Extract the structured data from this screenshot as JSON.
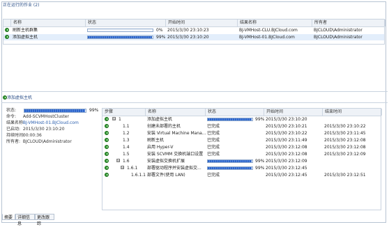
{
  "window": {
    "title": "正在运行的作业 (2)"
  },
  "jobs": {
    "columns": [
      "名称",
      "状态",
      "开始时间",
      "结果名称",
      "所有者"
    ],
    "rows": [
      {
        "name": "刷新主机群集",
        "progress": 0,
        "progress_text": "0%",
        "start": "2015/3/30 23:10:23",
        "result": "BJ-VMHost-CLU.BJCloud.com",
        "owner": "BJCLOUD\\Administrator"
      },
      {
        "name": "添加虚拟主机",
        "progress": 99,
        "progress_text": "99%",
        "start": "2015/3/30 23:10:20",
        "result": "BJ-VMHost-01.BJCloud.com",
        "owner": "BJCLOUD\\Administrator"
      }
    ]
  },
  "detail": {
    "title": "添加虚拟主机",
    "status_label": "状态:",
    "status_progress": 99,
    "status_progress_text": "99%",
    "command_label": "命令:",
    "command": "Add-SCVMHostCluster",
    "result_label": "结果名称:",
    "result": "BJ-VMHost-01.BJCloud.com",
    "started_label": "已启动:",
    "started": "2015/3/30 23:10:20",
    "duration_label": "持续时间:",
    "duration": "00:00:36",
    "owner_label": "所有者:",
    "owner": "BJCLOUD\\Administrator"
  },
  "steps": {
    "columns": [
      "步骤",
      "名称",
      "状态",
      "开始时间",
      "结束时间"
    ],
    "rows": [
      {
        "step": "1",
        "tree": "⊟",
        "name": "添加虚拟主机",
        "progress": 99,
        "status": "99%",
        "start": "2015/3/30 23:10:20",
        "end": ""
      },
      {
        "step": "1.1",
        "tree": "",
        "name": "创建未部署的主机",
        "progress": null,
        "status": "已完成",
        "start": "2015/3/30 23:10:21",
        "end": "2015/3/30 23:10:22"
      },
      {
        "step": "1.2",
        "tree": "",
        "name": "安装 Virtual Machine Mana...",
        "progress": null,
        "status": "已完成",
        "start": "2015/3/30 23:10:22",
        "end": "2015/3/30 23:11:45"
      },
      {
        "step": "1.3",
        "tree": "",
        "name": "刷新主机",
        "progress": null,
        "status": "已完成",
        "start": "2015/3/30 23:11:49",
        "end": "2015/3/30 23:12:08"
      },
      {
        "step": "1.4",
        "tree": "",
        "name": "启用 Hyper-V",
        "progress": null,
        "status": "已完成",
        "start": "2015/3/30 23:12:08",
        "end": "2015/3/30 23:12:08"
      },
      {
        "step": "1.5",
        "tree": "",
        "name": "安装 SCVMM 交换机端口设置",
        "progress": null,
        "status": "已完成",
        "start": "2015/3/30 23:12:08",
        "end": "2015/3/30 23:12:09"
      },
      {
        "step": "1.6",
        "tree": "⊟",
        "name": "安装虚拟交换机扩展",
        "progress": 99,
        "status": "99%",
        "start": "2015/3/30 23:12:09",
        "end": ""
      },
      {
        "step": "1.6.1",
        "tree": "⊟",
        "name": "部署驱动程序并安装虚拟交...",
        "progress": 99,
        "status": "99%",
        "start": "2015/3/30 23:12:45",
        "end": ""
      },
      {
        "step": "1.6.1.1",
        "tree": "",
        "name": "部署文件(使用 LAN)",
        "progress": null,
        "status": "已完成",
        "start": "2015/3/30 23:12:45",
        "end": "2015/3/30 23:12:51"
      }
    ]
  },
  "tabs": [
    "摘要",
    "详细信息",
    "更改跟踪"
  ]
}
